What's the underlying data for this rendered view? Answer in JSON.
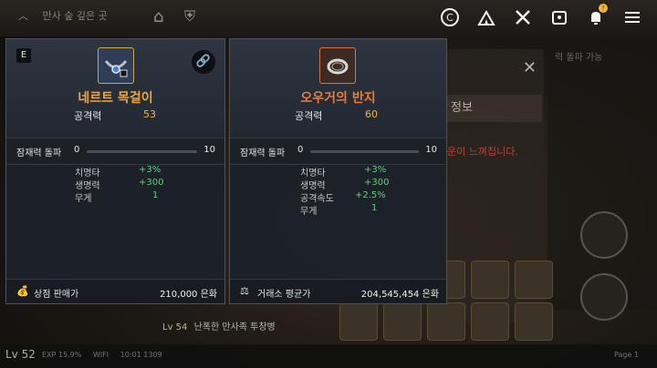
{
  "topbar": {
    "breadcrumb": "만사 숲 깊은 곳",
    "icons": [
      "copyright-icon",
      "camp-icon",
      "crossed-axes-icon",
      "bag-icon",
      "bell-icon",
      "menu-icon"
    ],
    "bell_badge": "!"
  },
  "cards": [
    {
      "grade": "E",
      "name": "네르트 목걸이",
      "attack_label": "공격력",
      "attack_value": "53",
      "limit_label": "잠재력 돌파",
      "limit_min": "0",
      "limit_max": "10",
      "stats": [
        {
          "k": "치명타",
          "v": "+3%"
        },
        {
          "k": "생명력",
          "v": "+300"
        },
        {
          "k": "무게",
          "v": "1"
        }
      ],
      "footer_label": "상점 판매가",
      "footer_value": "210,000 은화",
      "accent": "#f0a43e"
    },
    {
      "name": "오우거의 반지",
      "attack_label": "공격력",
      "attack_value": "60",
      "limit_label": "잠재력 돌파",
      "limit_min": "0",
      "limit_max": "10",
      "stats": [
        {
          "k": "치명타",
          "v": "+3%"
        },
        {
          "k": "생명력",
          "v": "+300"
        },
        {
          "k": "공격속도",
          "v": "+2.5%"
        },
        {
          "k": "무게",
          "v": "1"
        }
      ],
      "footer_label": "거래소 평균가",
      "footer_value": "204,545,454 은화",
      "accent": "#e97a3e"
    }
  ],
  "background": {
    "info_tab": "정보",
    "warning": "운이 느껴집니다.",
    "rt_label": "력 돌파 가능",
    "player_line_level": "Lv 54",
    "player_line_name": "난폭한 만사족 투창병"
  },
  "bottombar": {
    "level": "Lv 52",
    "exp": "EXP 15.9%",
    "wifi": "WIFI",
    "time": "10:01 1309",
    "page": "Page 1"
  }
}
